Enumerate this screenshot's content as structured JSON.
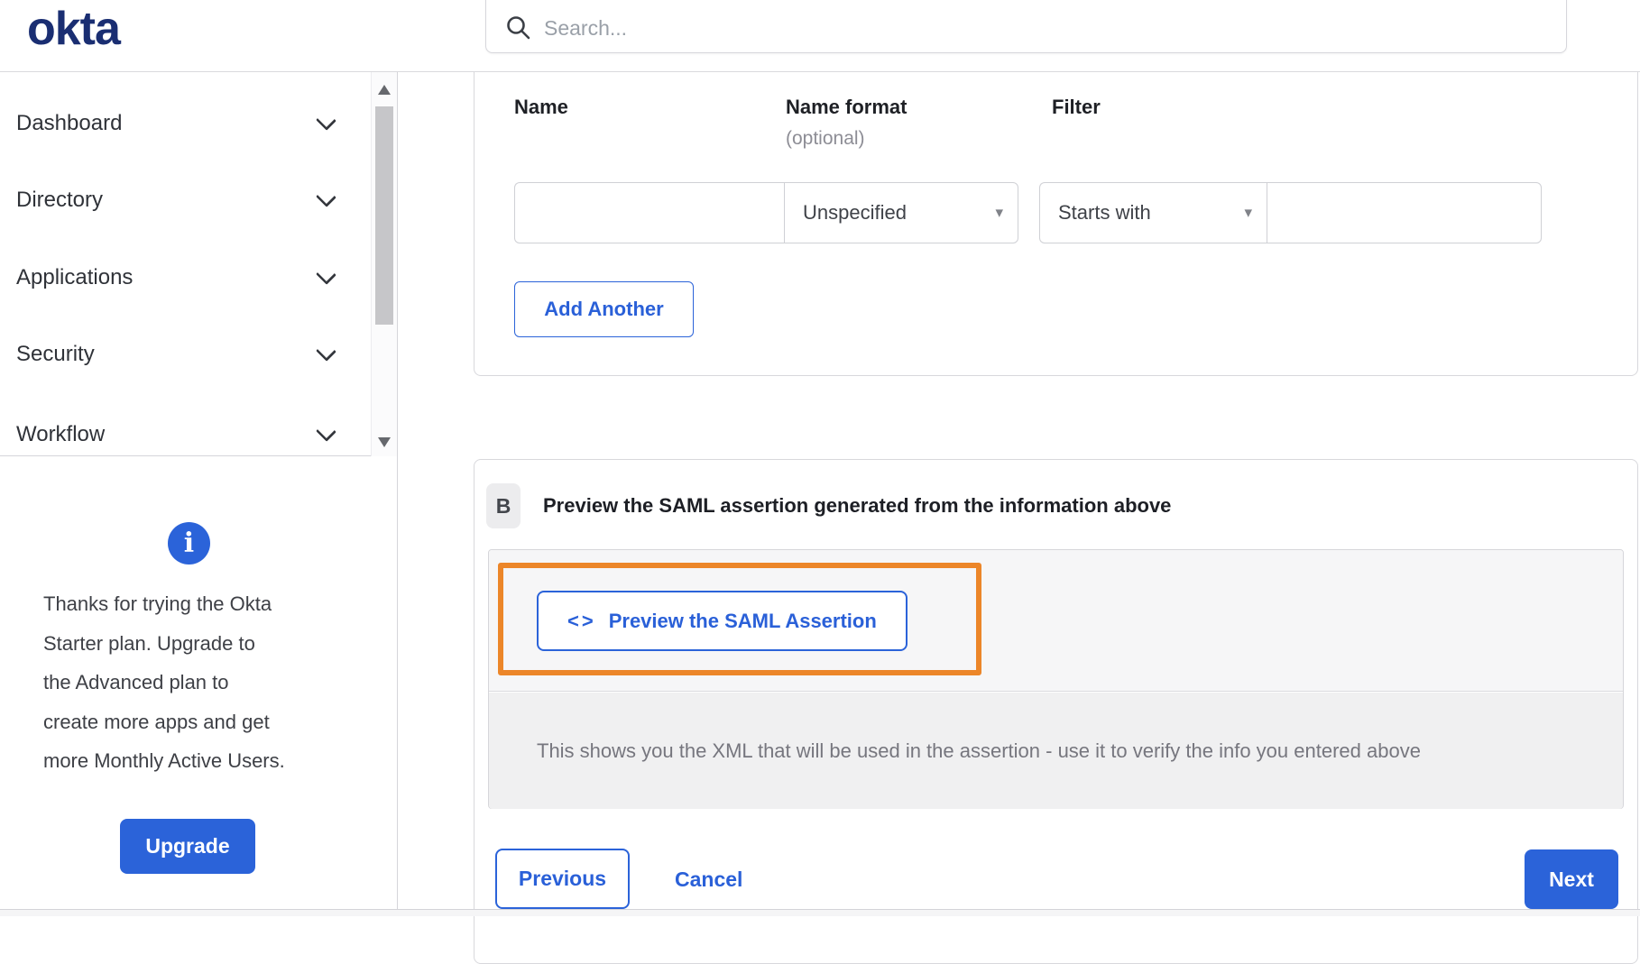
{
  "colors": {
    "navy": "#1a2e72",
    "accent": "#2a60d8",
    "accent_fill": "#2b63d9",
    "orange": "#ec8629"
  },
  "brand": {
    "logo_text": "okta"
  },
  "header": {
    "search": {
      "placeholder": "Search...",
      "icon": "search-icon"
    }
  },
  "sidebar": {
    "items": [
      {
        "label": "Dashboard",
        "icon": "chevron-down-icon"
      },
      {
        "label": "Directory",
        "icon": "chevron-down-icon"
      },
      {
        "label": "Applications",
        "icon": "chevron-down-icon"
      },
      {
        "label": "Security",
        "icon": "chevron-down-icon"
      },
      {
        "label": "Workflow",
        "icon": "chevron-down-icon"
      }
    ],
    "upgrade_panel": {
      "info_icon_glyph": "i",
      "lines": [
        "Thanks for trying the Okta",
        "Starter plan. Upgrade to",
        "the Advanced plan to",
        "create more apps and get",
        "more Monthly Active Users."
      ],
      "button_label": "Upgrade"
    }
  },
  "main": {
    "attribute_form": {
      "columns": [
        {
          "label": "Name"
        },
        {
          "label": "Name format",
          "sublabel": "(optional)"
        },
        {
          "label": "Filter"
        }
      ],
      "name_value": "",
      "name_format_value": "Unspecified",
      "filter_type_value": "Starts with",
      "filter_value": "",
      "caret_glyph": "▾",
      "add_another_label": "Add Another"
    },
    "preview_section": {
      "badge": "B",
      "heading": "Preview the SAML assertion generated from the information above",
      "code_icon_glyph": "<>",
      "preview_button_label": "Preview the SAML Assertion",
      "description": "This shows you the XML that will be used in the assertion - use it to verify the info you entered above"
    },
    "footer": {
      "previous_label": "Previous",
      "cancel_label": "Cancel",
      "next_label": "Next"
    }
  }
}
